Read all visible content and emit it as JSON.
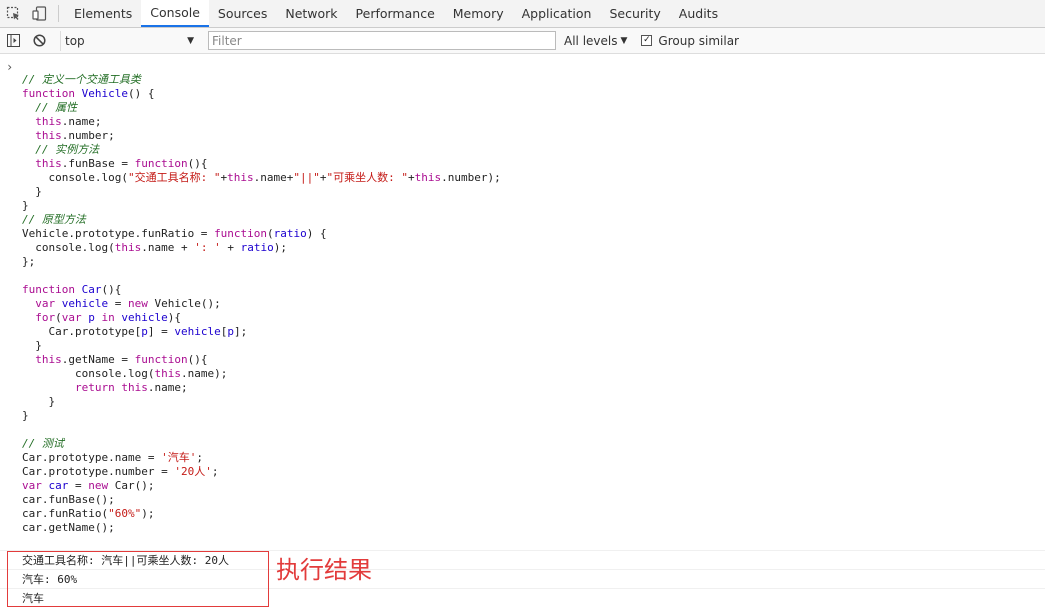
{
  "tabs": [
    "Elements",
    "Console",
    "Sources",
    "Network",
    "Performance",
    "Memory",
    "Application",
    "Security",
    "Audits"
  ],
  "active_tab": "Console",
  "toolbar": {
    "context": "top",
    "filter_placeholder": "Filter",
    "levels_label": "All levels",
    "group_similar_label": "Group similar",
    "group_similar_checked": true
  },
  "code_lines": [
    [
      [
        "cm",
        "// 定义一个交通工具类"
      ]
    ],
    [
      [
        "kw",
        "function"
      ],
      [
        "pl",
        " "
      ],
      [
        "fn",
        "Vehicle"
      ],
      [
        "pl",
        "() {"
      ]
    ],
    [
      [
        "pl",
        "  "
      ],
      [
        "cm",
        "// 属性"
      ]
    ],
    [
      [
        "pl",
        "  "
      ],
      [
        "kw",
        "this"
      ],
      [
        "pl",
        ".name;"
      ]
    ],
    [
      [
        "pl",
        "  "
      ],
      [
        "kw",
        "this"
      ],
      [
        "pl",
        ".number;"
      ]
    ],
    [
      [
        "pl",
        "  "
      ],
      [
        "cm",
        "// 实例方法"
      ]
    ],
    [
      [
        "pl",
        "  "
      ],
      [
        "kw",
        "this"
      ],
      [
        "pl",
        ".funBase = "
      ],
      [
        "kw",
        "function"
      ],
      [
        "pl",
        "(){"
      ]
    ],
    [
      [
        "pl",
        "    console.log("
      ],
      [
        "st",
        "\"交通工具名称: \""
      ],
      [
        "pl",
        "+"
      ],
      [
        "kw",
        "this"
      ],
      [
        "pl",
        ".name+"
      ],
      [
        "st",
        "\"||\""
      ],
      [
        "pl",
        "+"
      ],
      [
        "st",
        "\"可乘坐人数: \""
      ],
      [
        "pl",
        "+"
      ],
      [
        "kw",
        "this"
      ],
      [
        "pl",
        ".number);"
      ]
    ],
    [
      [
        "pl",
        "  }"
      ]
    ],
    [
      [
        "pl",
        "}"
      ]
    ],
    [
      [
        "cm",
        "// 原型方法"
      ]
    ],
    [
      [
        "pl",
        "Vehicle.prototype.funRatio = "
      ],
      [
        "kw",
        "function"
      ],
      [
        "pl",
        "("
      ],
      [
        "fn",
        "ratio"
      ],
      [
        "pl",
        ") {"
      ]
    ],
    [
      [
        "pl",
        "  console.log("
      ],
      [
        "kw",
        "this"
      ],
      [
        "pl",
        ".name + "
      ],
      [
        "st",
        "': '"
      ],
      [
        "pl",
        " + "
      ],
      [
        "fn",
        "ratio"
      ],
      [
        "pl",
        ");"
      ]
    ],
    [
      [
        "pl",
        "};"
      ]
    ],
    [
      [
        "pl",
        ""
      ]
    ],
    [
      [
        "kw",
        "function"
      ],
      [
        "pl",
        " "
      ],
      [
        "fn",
        "Car"
      ],
      [
        "pl",
        "(){"
      ]
    ],
    [
      [
        "pl",
        "  "
      ],
      [
        "kw",
        "var"
      ],
      [
        "pl",
        " "
      ],
      [
        "fn",
        "vehicle"
      ],
      [
        "pl",
        " = "
      ],
      [
        "kw",
        "new"
      ],
      [
        "pl",
        " Vehicle();"
      ]
    ],
    [
      [
        "pl",
        "  "
      ],
      [
        "kw",
        "for"
      ],
      [
        "pl",
        "("
      ],
      [
        "kw",
        "var"
      ],
      [
        "pl",
        " "
      ],
      [
        "fn",
        "p"
      ],
      [
        "pl",
        " "
      ],
      [
        "kw",
        "in"
      ],
      [
        "pl",
        " "
      ],
      [
        "fn",
        "vehicle"
      ],
      [
        "pl",
        "){"
      ]
    ],
    [
      [
        "pl",
        "    Car.prototype["
      ],
      [
        "fn",
        "p"
      ],
      [
        "pl",
        "] = "
      ],
      [
        "fn",
        "vehicle"
      ],
      [
        "pl",
        "["
      ],
      [
        "fn",
        "p"
      ],
      [
        "pl",
        "];"
      ]
    ],
    [
      [
        "pl",
        "  }"
      ]
    ],
    [
      [
        "pl",
        "  "
      ],
      [
        "kw",
        "this"
      ],
      [
        "pl",
        ".getName = "
      ],
      [
        "kw",
        "function"
      ],
      [
        "pl",
        "(){"
      ]
    ],
    [
      [
        "pl",
        "        console.log("
      ],
      [
        "kw",
        "this"
      ],
      [
        "pl",
        ".name);"
      ]
    ],
    [
      [
        "pl",
        "        "
      ],
      [
        "kw",
        "return"
      ],
      [
        "pl",
        " "
      ],
      [
        "kw",
        "this"
      ],
      [
        "pl",
        ".name;"
      ]
    ],
    [
      [
        "pl",
        "    }"
      ]
    ],
    [
      [
        "pl",
        "}"
      ]
    ],
    [
      [
        "pl",
        ""
      ]
    ],
    [
      [
        "cm",
        "// 测试"
      ]
    ],
    [
      [
        "pl",
        "Car.prototype.name = "
      ],
      [
        "st",
        "'汽车'"
      ],
      [
        "pl",
        ";"
      ]
    ],
    [
      [
        "pl",
        "Car.prototype.number = "
      ],
      [
        "st",
        "'20人'"
      ],
      [
        "pl",
        ";"
      ]
    ],
    [
      [
        "kw",
        "var"
      ],
      [
        "pl",
        " "
      ],
      [
        "fn",
        "car"
      ],
      [
        "pl",
        " = "
      ],
      [
        "kw",
        "new"
      ],
      [
        "pl",
        " Car();"
      ]
    ],
    [
      [
        "pl",
        "car.funBase();"
      ]
    ],
    [
      [
        "pl",
        "car.funRatio("
      ],
      [
        "st",
        "\"60%\""
      ],
      [
        "pl",
        ");"
      ]
    ],
    [
      [
        "pl",
        "car.getName();"
      ]
    ]
  ],
  "output_lines": [
    "交通工具名称: 汽车||可乘坐人数: 20人",
    "汽车: 60%",
    "汽车"
  ],
  "annotation": "执行结果",
  "colors": {
    "annotation": "#e23b3b",
    "active_tab_underline": "#1a73e8"
  }
}
